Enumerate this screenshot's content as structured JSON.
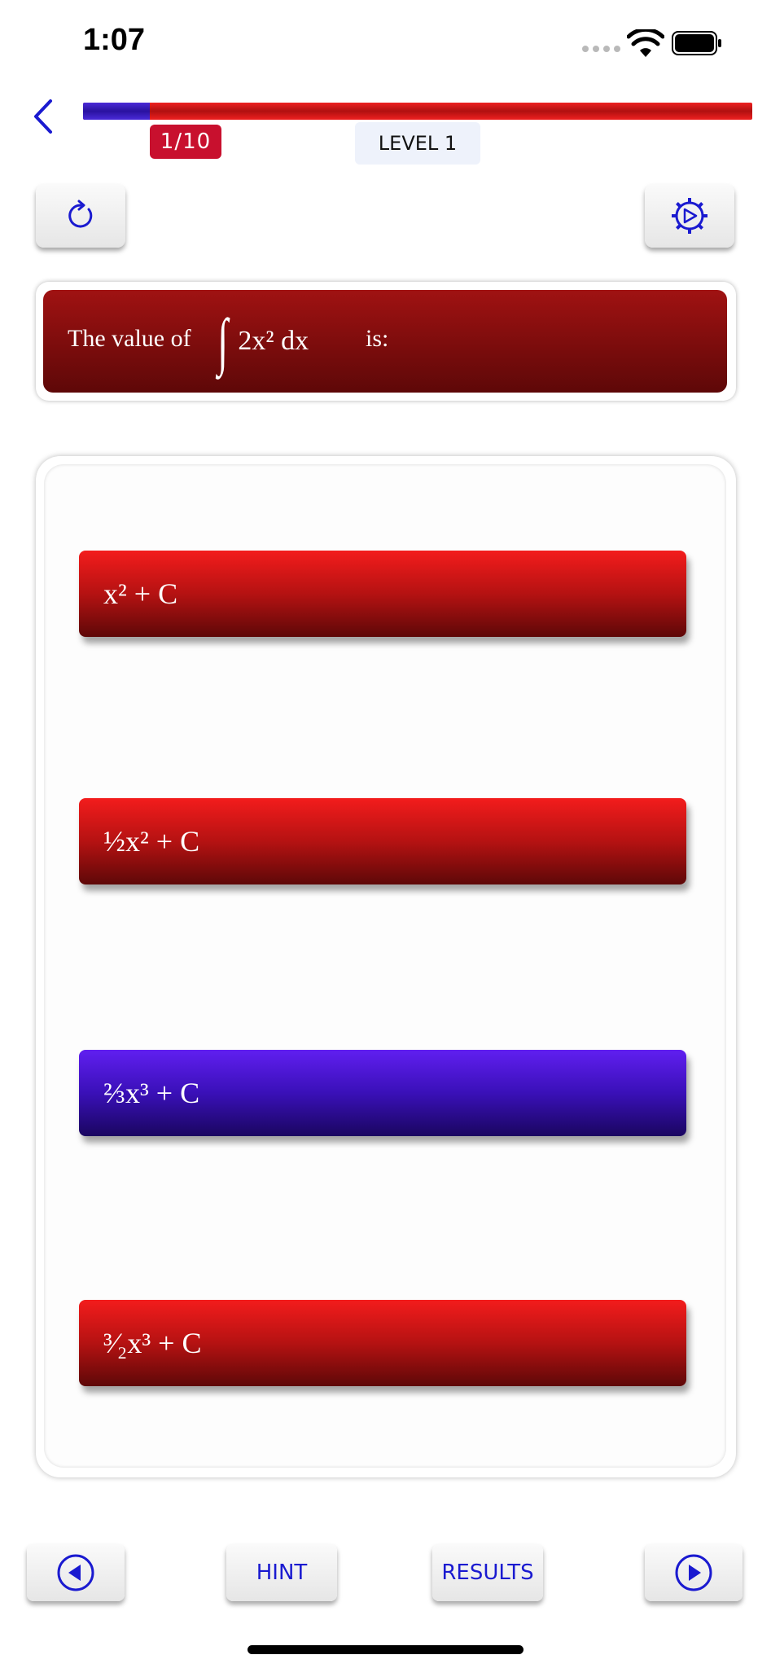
{
  "status_bar": {
    "time": "1:07"
  },
  "nav": {
    "progress_fraction": 0.1,
    "counter": "1/10",
    "level": "LEVEL 1"
  },
  "question": {
    "prefix": "The value of",
    "integrand": "2x² dx",
    "suffix": "is:"
  },
  "answers": [
    {
      "text": "x² + C",
      "selected": false
    },
    {
      "text": "½x² + C",
      "selected": false
    },
    {
      "text": "⅔x³ + C",
      "selected": true
    },
    {
      "text": "³⁄₂x³ + C",
      "selected": false
    }
  ],
  "toolbar": {
    "hint_label": "HINT",
    "results_label": "RESULTS"
  },
  "colors": {
    "accent_blue": "#1a1ad0",
    "answer_red": "#e01818",
    "answer_selected": "#4a14d8",
    "question_bg": "#8a1010",
    "counter_bg": "#c8102e"
  },
  "icons": {
    "back": "chevron-left-icon",
    "refresh": "refresh-icon",
    "settings": "gear-icon",
    "prev": "play-left-icon",
    "next": "play-right-icon"
  }
}
